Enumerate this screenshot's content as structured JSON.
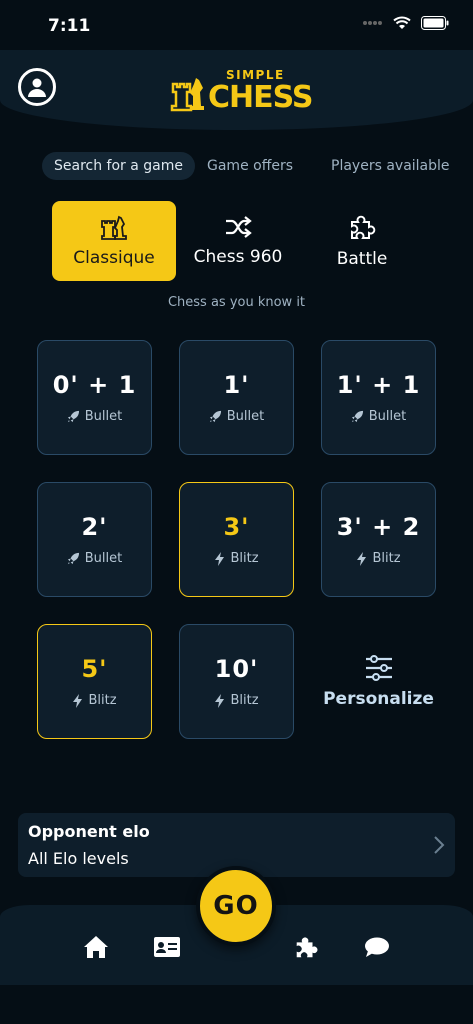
{
  "status": {
    "time": "7:11"
  },
  "logo": {
    "top": "SIMPLE",
    "main": "CHESS"
  },
  "tabs": [
    {
      "label": "Search for a game",
      "active": true
    },
    {
      "label": "Game offers",
      "active": false
    },
    {
      "label": "Players available",
      "active": false
    }
  ],
  "modes": [
    {
      "label": "Classique",
      "icon": "chess-pieces-icon",
      "active": true
    },
    {
      "label": "Chess 960",
      "icon": "shuffle-icon",
      "active": false
    },
    {
      "label": "Battle",
      "icon": "puzzle-icon",
      "active": false
    }
  ],
  "mode_description": "Chess as you know it",
  "time_controls": [
    {
      "time": "0' + 1",
      "type": "Bullet",
      "icon": "rocket-icon",
      "selected": false
    },
    {
      "time": "1'",
      "type": "Bullet",
      "icon": "rocket-icon",
      "selected": false
    },
    {
      "time": "1' + 1",
      "type": "Bullet",
      "icon": "rocket-icon",
      "selected": false
    },
    {
      "time": "2'",
      "type": "Bullet",
      "icon": "rocket-icon",
      "selected": false
    },
    {
      "time": "3'",
      "type": "Blitz",
      "icon": "lightning-icon",
      "selected": true
    },
    {
      "time": "3' + 2",
      "type": "Blitz",
      "icon": "lightning-icon",
      "selected": false
    },
    {
      "time": "5'",
      "type": "Blitz",
      "icon": "lightning-icon",
      "selected": true
    },
    {
      "time": "10'",
      "type": "Blitz",
      "icon": "lightning-icon",
      "selected": false
    }
  ],
  "personalize": {
    "label": "Personalize",
    "icon": "sliders-icon"
  },
  "opponent_elo": {
    "title": "Opponent elo",
    "value": "All Elo levels"
  },
  "go_button": {
    "label": "GO"
  },
  "nav": [
    "home-icon",
    "id-card-icon",
    "puzzle-icon",
    "chat-icon"
  ],
  "colors": {
    "accent": "#f5c816",
    "background": "#050e15",
    "surface": "#0e1e2b",
    "tile_border": "#2a4a66"
  }
}
